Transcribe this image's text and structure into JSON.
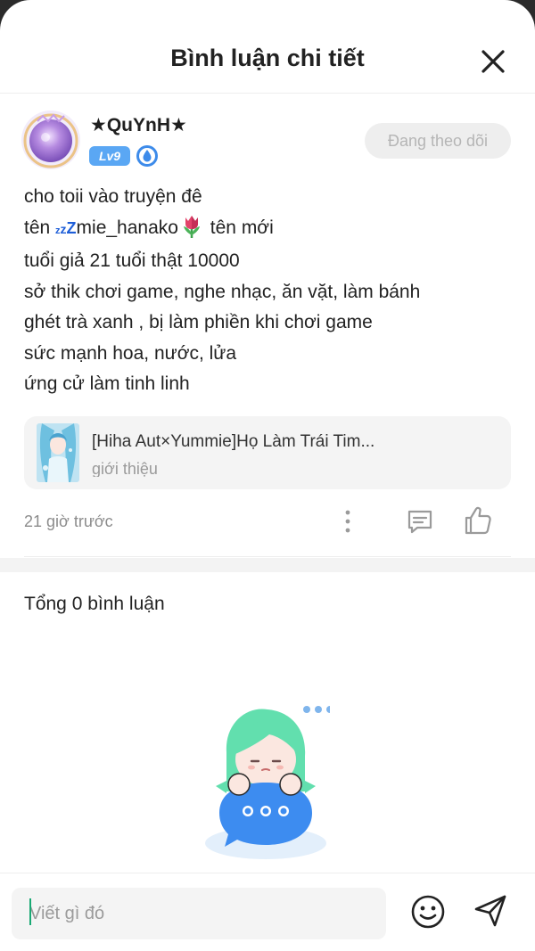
{
  "header": {
    "title": "Bình luận chi tiết"
  },
  "post": {
    "username": "★QuYnH★",
    "level": "Lv9",
    "follow_label": "Đang theo dõi",
    "content": {
      "line1": "cho toii vào truyện đê",
      "line2_prefix": "tên ",
      "line2_zz": "zzZ",
      "line2_name": "mie_hanako",
      "line2_suffix": " tên mới",
      "line3": "tuổi giả 21 tuổi thật 10000",
      "line4": "sở thik chơi game, nghe nhạc, ăn vặt, làm bánh",
      "line5": "ghét trà xanh , bị làm phiền khi chơi game",
      "line6": "sức mạnh hoa, nước, lửa",
      "line7": "ứng cử làm tinh linh"
    },
    "story_card": {
      "title": "[Hiha Aut×Yummie]Họ Làm Trái Tim...",
      "subtitle": "giới thiệu"
    },
    "timestamp": "21 giờ trước"
  },
  "comments": {
    "total_label": "Tổng 0 bình luận"
  },
  "composer": {
    "placeholder": "Viết gì đó"
  },
  "icons": {
    "close": "close-icon",
    "level": "level-badge",
    "rank": "water-drop-rank-icon",
    "more": "more-vertical-icon",
    "reply": "comment-icon",
    "like": "thumbs-up-icon",
    "emoji": "smiley-icon",
    "send": "send-icon",
    "tulip": "tulip-emoji"
  },
  "colors": {
    "accent_blue": "#5aa7f4",
    "zz_blue": "#1e5ed8",
    "cursor_green": "#19a974",
    "text_primary": "#222222",
    "text_secondary": "#8c8c8c"
  }
}
